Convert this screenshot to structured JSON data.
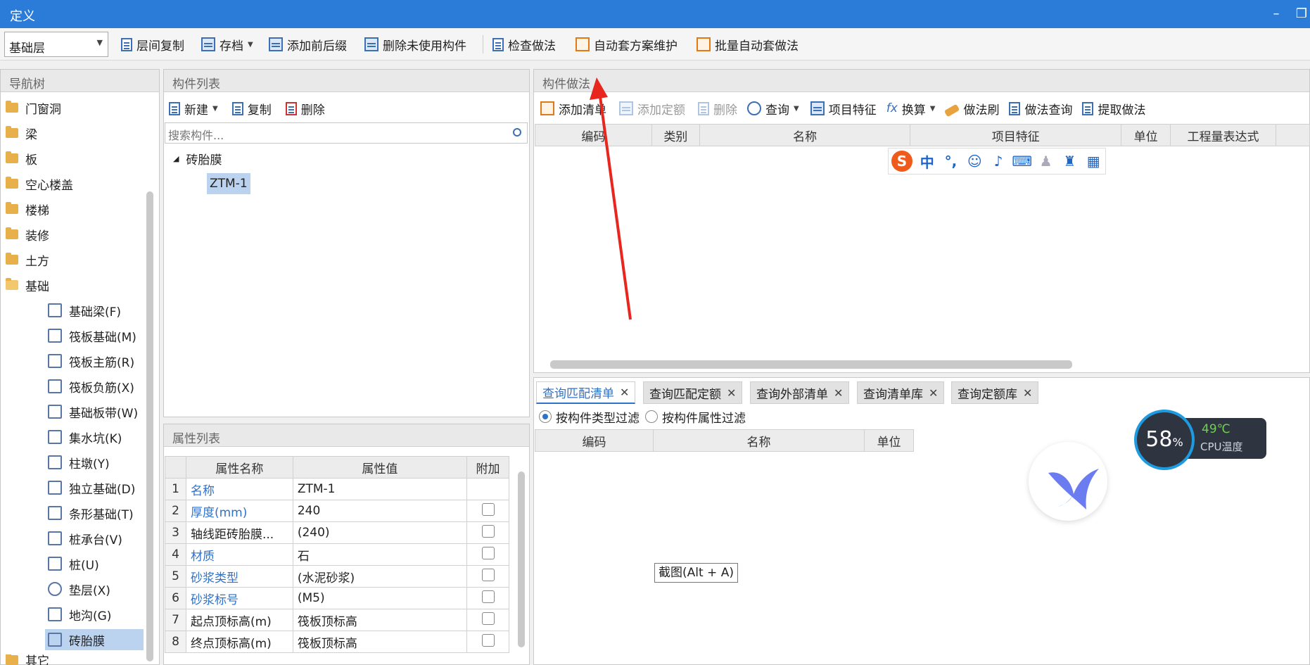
{
  "window": {
    "title": "定义"
  },
  "toolbar": {
    "layer_select": "基础层",
    "buttons": [
      "层间复制",
      "存档",
      "添加前后缀",
      "删除未使用构件",
      "检查做法",
      "自动套方案维护",
      "批量自动套做法"
    ]
  },
  "nav": {
    "header": "导航树",
    "items": [
      "门窗洞",
      "梁",
      "板",
      "空心楼盖",
      "楼梯",
      "装修",
      "土方",
      "基础"
    ],
    "sub_items": [
      "基础梁(F)",
      "筏板基础(M)",
      "筏板主筋(R)",
      "筏板负筋(X)",
      "基础板带(W)",
      "集水坑(K)",
      "柱墩(Y)",
      "独立基础(D)",
      "条形基础(T)",
      "桩承台(V)",
      "桩(U)",
      "垫层(X)",
      "地沟(G)",
      "砖胎膜"
    ],
    "last_item": "其它"
  },
  "component_list": {
    "header": "构件列表",
    "new_label": "新建",
    "copy_label": "复制",
    "delete_label": "删除",
    "search_placeholder": "搜索构件...",
    "tree_parent": "砖胎膜",
    "tree_child": "ZTM-1"
  },
  "properties": {
    "header": "属性列表",
    "columns": [
      "属性名称",
      "属性值",
      "附加"
    ],
    "rows": [
      {
        "num": "1",
        "name": "名称",
        "value": "ZTM-1"
      },
      {
        "num": "2",
        "name": "厚度(mm)",
        "value": "240"
      },
      {
        "num": "3",
        "name": "轴线距砖胎膜...",
        "value": "(240)"
      },
      {
        "num": "4",
        "name": "材质",
        "value": "石"
      },
      {
        "num": "5",
        "name": "砂浆类型",
        "value": "(水泥砂浆)"
      },
      {
        "num": "6",
        "name": "砂浆标号",
        "value": "(M5)"
      },
      {
        "num": "7",
        "name": "起点顶标高(m)",
        "value": "筏板顶标高"
      },
      {
        "num": "8",
        "name": "终点顶标高(m)",
        "value": "筏板顶标高"
      }
    ]
  },
  "method": {
    "header": "构件做法",
    "buttons": [
      "添加清单",
      "添加定额",
      "删除",
      "查询",
      "项目特征",
      "换算",
      "做法刷",
      "做法查询",
      "提取做法"
    ],
    "columns": [
      "编码",
      "类别",
      "名称",
      "项目特征",
      "单位",
      "工程量表达式"
    ]
  },
  "query": {
    "tabs": [
      "查询匹配清单",
      "查询匹配定额",
      "查询外部清单",
      "查询清单库",
      "查询定额库"
    ],
    "filter_type": "按构件类型过滤",
    "filter_attr": "按构件属性过滤",
    "columns": [
      "编码",
      "名称",
      "单位"
    ]
  },
  "ime": {
    "label": "中"
  },
  "cpu": {
    "usage": "58",
    "unit": "%",
    "temp": "49℃",
    "label": "CPU温度"
  },
  "tooltip": "截图(Alt + A)",
  "colors": {
    "titlebar": "#2b7cd8",
    "accent": "#2f72c9",
    "arrow": "#e8261e"
  }
}
